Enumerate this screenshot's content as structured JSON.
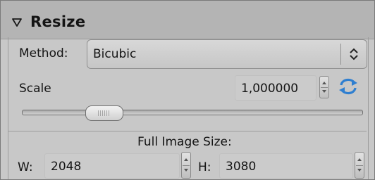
{
  "panel": {
    "title": "Resize",
    "expanded": true
  },
  "method": {
    "label": "Method:",
    "value": "Bicubic"
  },
  "scale": {
    "label": "Scale",
    "value": "1,000000",
    "slider_level": 0.21
  },
  "full_image_size": {
    "label": "Full Image Size:",
    "width_label": "W:",
    "width_value": "2048",
    "height_label": "H:",
    "height_value": "3080"
  },
  "icons": {
    "toggle": "collapse-triangle-down",
    "dropdown": "up-down-chevron",
    "link": "refresh-sync-arrows"
  },
  "colors": {
    "accent": "#2f7fd0"
  }
}
